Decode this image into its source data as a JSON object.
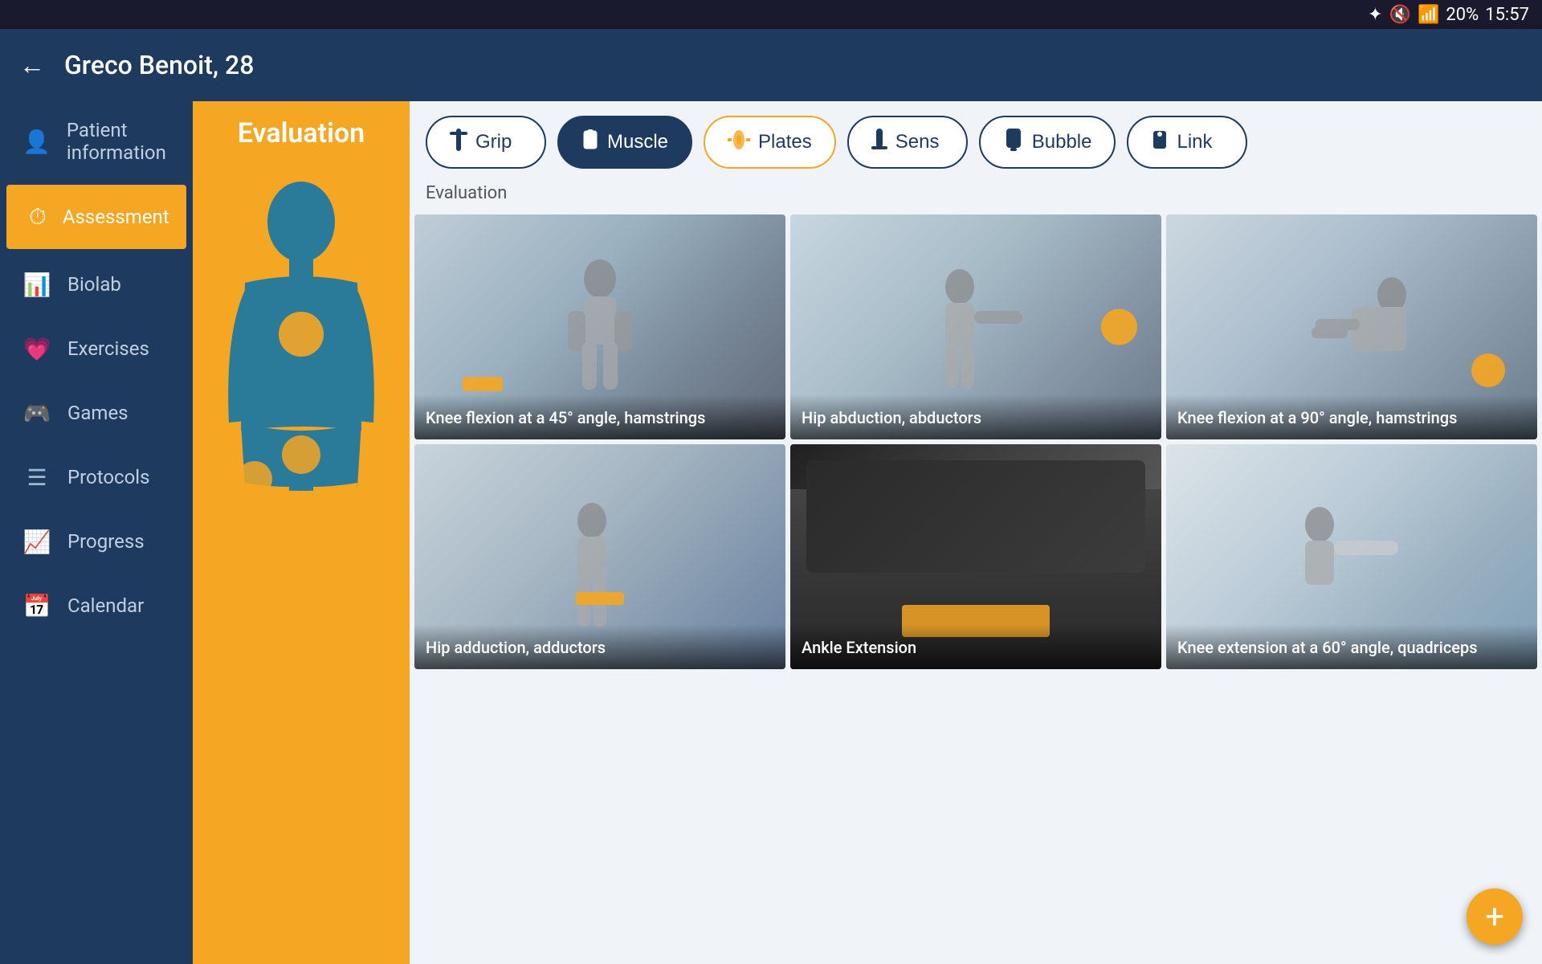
{
  "statusBar": {
    "battery": "20%",
    "time": "15:57",
    "icons": [
      "bluetooth",
      "mute",
      "wifi"
    ]
  },
  "header": {
    "patientName": "Greco Benoit, 28",
    "backLabel": "←"
  },
  "sidebar": {
    "items": [
      {
        "id": "patient-info",
        "label": "Patient information",
        "icon": "👤",
        "active": false
      },
      {
        "id": "assessment",
        "label": "Assessment",
        "icon": "⏱",
        "active": true
      },
      {
        "id": "biolab",
        "label": "Biolab",
        "icon": "📊",
        "active": false
      },
      {
        "id": "exercises",
        "label": "Exercises",
        "icon": "💗",
        "active": false
      },
      {
        "id": "games",
        "label": "Games",
        "icon": "🎮",
        "active": false
      },
      {
        "id": "protocols",
        "label": "Protocols",
        "icon": "☰",
        "active": false
      },
      {
        "id": "progress",
        "label": "Progress",
        "icon": "📈",
        "active": false
      },
      {
        "id": "calendar",
        "label": "Calendar",
        "icon": "📅",
        "active": false
      }
    ]
  },
  "leftPanel": {
    "title": "Evaluation"
  },
  "tools": [
    {
      "id": "grip",
      "label": "Grip",
      "active": false,
      "icon": "grip"
    },
    {
      "id": "muscle",
      "label": "Muscle",
      "active": true,
      "icon": "muscle"
    },
    {
      "id": "plates",
      "label": "Plates",
      "active": false,
      "icon": "plates"
    },
    {
      "id": "sens",
      "label": "Sens",
      "active": false,
      "icon": "sens"
    },
    {
      "id": "bubble",
      "label": "Bubble",
      "active": false,
      "icon": "bubble"
    },
    {
      "id": "link",
      "label": "Link",
      "active": false,
      "icon": "link"
    }
  ],
  "sectionLabel": "Evaluation",
  "exercises": [
    {
      "id": 1,
      "label": "Knee flexion at a 45° angle, hamstrings",
      "imgClass": "img-knee-flex45"
    },
    {
      "id": 2,
      "label": "Hip abduction, abductors",
      "imgClass": "img-hip-abduction"
    },
    {
      "id": 3,
      "label": "Knee flexion at a 90° angle, hamstrings",
      "imgClass": "img-knee-flex90"
    },
    {
      "id": 4,
      "label": "Hip adduction, adductors",
      "imgClass": "img-hip-adduction"
    },
    {
      "id": 5,
      "label": "Ankle Extension",
      "imgClass": "img-ankle-ext"
    },
    {
      "id": 6,
      "label": "Knee extension at a 60° angle, quadriceps",
      "imgClass": "img-knee-ext60"
    }
  ],
  "fab": {
    "label": "+"
  }
}
